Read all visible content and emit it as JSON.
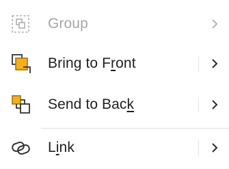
{
  "menu": {
    "items": [
      {
        "pre": "Group",
        "accel": "",
        "post": "",
        "icon": "group-icon",
        "disabled": true
      },
      {
        "pre": "Bring to F",
        "accel": "r",
        "post": "ont",
        "icon": "bring-to-front-icon",
        "disabled": false
      },
      {
        "pre": "Send to Bac",
        "accel": "k",
        "post": "",
        "icon": "send-to-back-icon",
        "disabled": false
      },
      {
        "pre": "L",
        "accel": "i",
        "post": "nk",
        "icon": "link-icon",
        "disabled": false
      }
    ]
  },
  "colors": {
    "text": "#1f1f1f",
    "disabled_text": "#a6a6a6",
    "icon_accent": "#f2b01e",
    "icon_stroke": "#333333"
  }
}
